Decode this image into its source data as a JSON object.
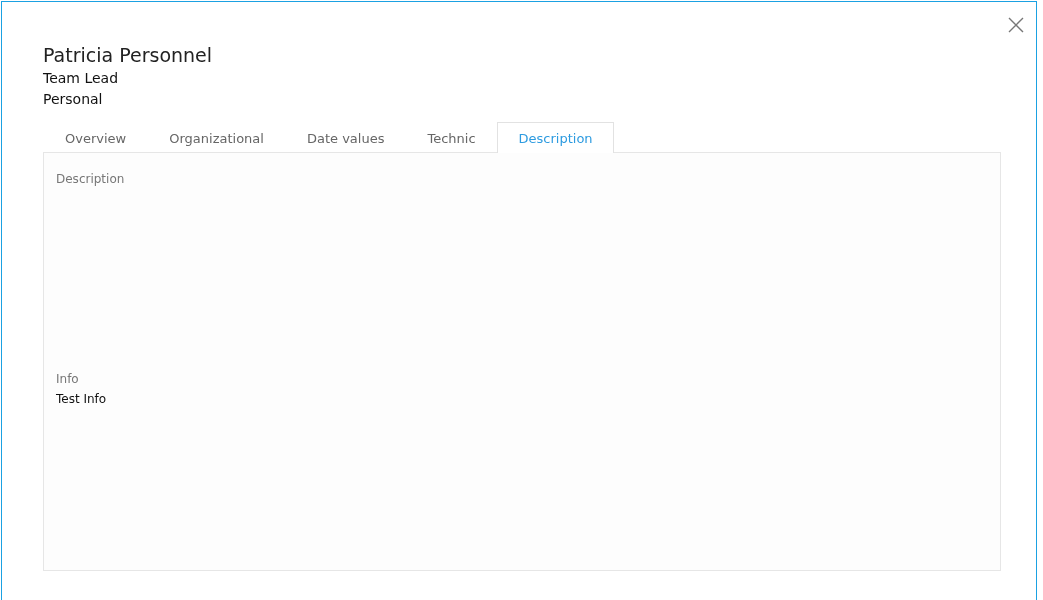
{
  "dialog": {
    "title": "Patricia Personnel",
    "subtitle": "Team Lead",
    "category": "Personal"
  },
  "tabs": [
    {
      "label": "Overview",
      "selected": false
    },
    {
      "label": "Organizational",
      "selected": false
    },
    {
      "label": "Date values",
      "selected": false
    },
    {
      "label": "Technic",
      "selected": false
    },
    {
      "label": "Description",
      "selected": true
    }
  ],
  "fields": [
    {
      "label": "Description"
    },
    {
      "label": "Info",
      "value": "Test Info"
    }
  ]
}
